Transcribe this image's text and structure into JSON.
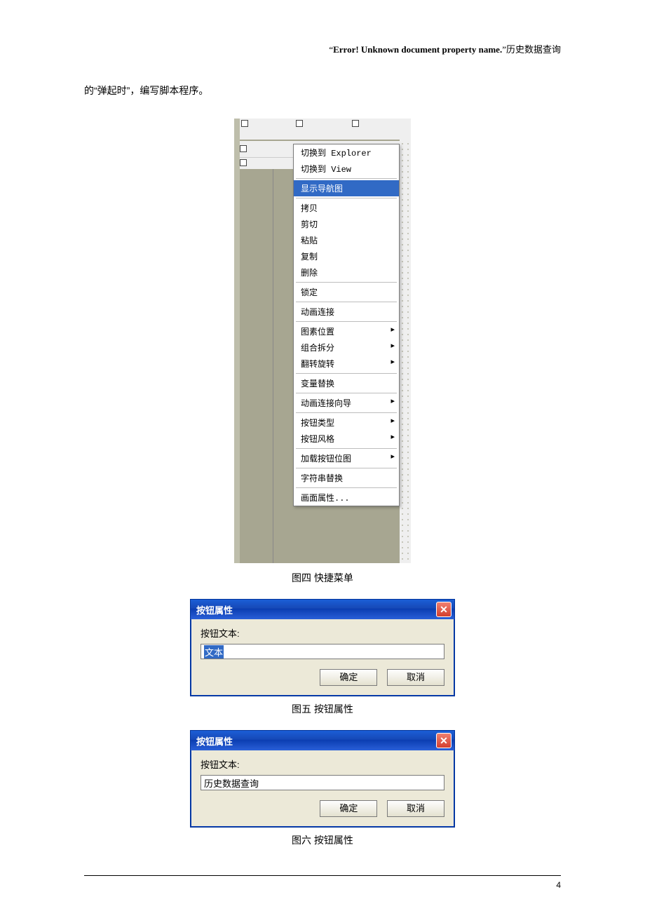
{
  "header": {
    "quote_open": "“",
    "error_text": "Error! Unknown document property name.",
    "quote_close": "”",
    "suffix": "历史数据查询"
  },
  "body_line": "的“弹起时”，编写脚本程序。",
  "fig4": {
    "caption": "图四  快捷菜单",
    "menu": {
      "items": [
        {
          "label": "切换到 Explorer",
          "sep": false,
          "arrow": false,
          "hl": false
        },
        {
          "label": "切换到 View",
          "sep": false,
          "arrow": false,
          "hl": false
        },
        {
          "sep": true
        },
        {
          "label": "显示导航图",
          "sep": false,
          "arrow": false,
          "hl": true
        },
        {
          "sep": true
        },
        {
          "label": "拷贝",
          "arrow": false
        },
        {
          "label": "剪切",
          "arrow": false
        },
        {
          "label": "粘贴",
          "arrow": false
        },
        {
          "label": "复制",
          "arrow": false
        },
        {
          "label": "删除",
          "arrow": false
        },
        {
          "sep": true
        },
        {
          "label": "锁定",
          "arrow": false
        },
        {
          "sep": true
        },
        {
          "label": "动画连接",
          "arrow": false
        },
        {
          "sep": true
        },
        {
          "label": "图素位置",
          "arrow": true
        },
        {
          "label": "组合拆分",
          "arrow": true
        },
        {
          "label": "翻转旋转",
          "arrow": true
        },
        {
          "sep": true
        },
        {
          "label": "变量替换",
          "arrow": false
        },
        {
          "sep": true
        },
        {
          "label": "动画连接向导",
          "arrow": true
        },
        {
          "sep": true
        },
        {
          "label": "按钮类型",
          "arrow": true
        },
        {
          "label": "按钮风格",
          "arrow": true
        },
        {
          "sep": true
        },
        {
          "label": "加载按钮位图",
          "arrow": true
        },
        {
          "sep": true
        },
        {
          "label": "字符串替换",
          "arrow": false
        },
        {
          "sep": true
        },
        {
          "label": "画面属性...",
          "arrow": false
        }
      ]
    }
  },
  "fig5": {
    "caption": "图五  按钮属性",
    "title": "按钮属性",
    "label": "按钮文本:",
    "value": "文本",
    "ok": "确定",
    "cancel": "取消"
  },
  "fig6": {
    "caption": "图六  按钮属性",
    "title": "按钮属性",
    "label": "按钮文本:",
    "value": "历史数据查询",
    "ok": "确定",
    "cancel": "取消"
  },
  "page_number": "4"
}
